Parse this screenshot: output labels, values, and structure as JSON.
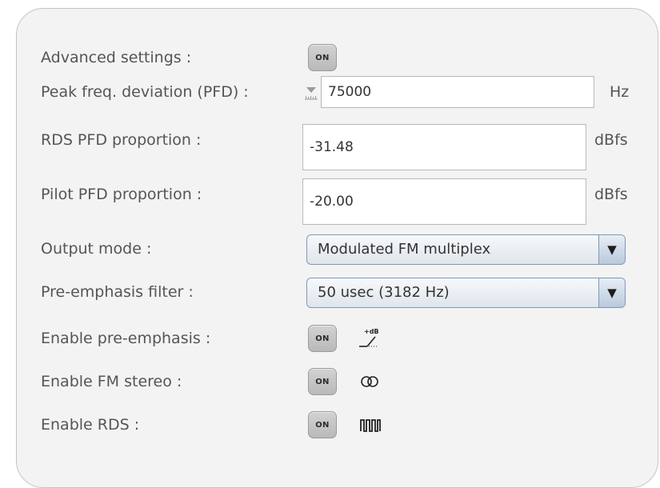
{
  "form": {
    "advanced_settings": {
      "label": "Advanced settings :",
      "toggle": "ON"
    },
    "pfd": {
      "label": "Peak freq. deviation (PFD) :",
      "value": "75000",
      "unit": "Hz",
      "spin_icon": "spin-adjust-icon"
    },
    "rds_pfd": {
      "label": "RDS PFD proportion :",
      "value": "-31.48",
      "unit": "dBfs"
    },
    "pilot_pfd": {
      "label": "Pilot PFD proportion :",
      "value": "-20.00",
      "unit": "dBfs"
    },
    "output_mode": {
      "label": "Output mode :",
      "selected": "Modulated FM multiplex",
      "arrow": "▼"
    },
    "pre_emphasis_filter": {
      "label": "Pre-emphasis filter :",
      "selected": "50 usec (3182 Hz)",
      "arrow": "▼"
    },
    "enable_pre_emphasis": {
      "label": "Enable pre-emphasis :",
      "toggle": "ON",
      "icon_text": "+dB",
      "icon": "pre-emphasis-icon"
    },
    "enable_fm_stereo": {
      "label": "Enable FM stereo :",
      "toggle": "ON",
      "icon": "stereo-icon"
    },
    "enable_rds": {
      "label": "Enable RDS :",
      "toggle": "ON",
      "icon": "rds-waveform-icon"
    }
  }
}
